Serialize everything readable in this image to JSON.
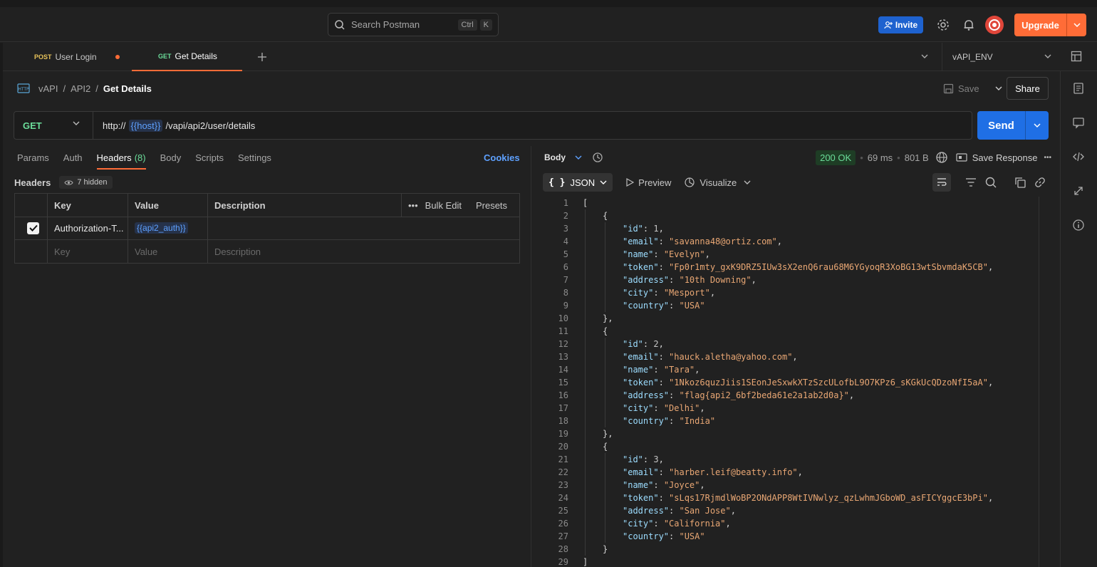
{
  "topbar": {
    "search_placeholder": "Search Postman",
    "kbd": [
      "Ctrl",
      "K"
    ],
    "invite_label": "Invite",
    "upgrade_label": "Upgrade"
  },
  "tabs": [
    {
      "method": "POST",
      "name": "User Login",
      "unsaved": true
    },
    {
      "method": "GET",
      "name": "Get Details",
      "active": true
    }
  ],
  "environment": "vAPI_ENV",
  "breadcrumb": {
    "badge": "HTTP",
    "items": [
      "vAPI",
      "API2"
    ],
    "current": "Get Details"
  },
  "actions": {
    "save": "Save",
    "share": "Share"
  },
  "request": {
    "method": "GET",
    "url_prefix": "http://",
    "url_var": "{{host}}",
    "url_path": "/vapi/api2/user/details",
    "send_label": "Send"
  },
  "request_tabs": {
    "params": "Params",
    "auth": "Auth",
    "headers": "Headers",
    "headers_count": "(8)",
    "body": "Body",
    "scripts": "Scripts",
    "settings": "Settings",
    "cookies": "Cookies"
  },
  "headers_section": {
    "title": "Headers",
    "hidden": "7 hidden",
    "columns": [
      "Key",
      "Value",
      "Description"
    ],
    "bulk_edit": "Bulk Edit",
    "presets": "Presets",
    "row": {
      "key": "Authorization-T...",
      "value": "{{api2_auth}}",
      "description": ""
    },
    "placeholders": {
      "key": "Key",
      "value": "Value",
      "description": "Description"
    }
  },
  "response": {
    "body_label": "Body",
    "status": "200 OK",
    "time": "69 ms",
    "size": "801 B",
    "save_response": "Save Response",
    "format": "JSON",
    "preview": "Preview",
    "visualize": "Visualize"
  },
  "code_lines": [
    "1",
    "2",
    "3",
    "4",
    "5",
    "6",
    "7",
    "8",
    "9",
    "10",
    "11",
    "12",
    "13",
    "14",
    "15",
    "16",
    "17",
    "18",
    "19",
    "20",
    "21",
    "22",
    "23",
    "24",
    "25",
    "26",
    "27",
    "28",
    "29"
  ],
  "json_body": [
    {
      "id": "1",
      "email": "\"savanna48@ortiz.com\"",
      "name": "\"Evelyn\"",
      "token": "\"Fp0r1mty_gxK9DRZ5IUw3sX2enQ6rau68M6YGyoqR3XoBG13wtSbvmdaK5CB\"",
      "address": "\"10th Downing\"",
      "city": "\"Mesport\"",
      "country": "\"USA\""
    },
    {
      "id": "2",
      "email": "\"hauck.aletha@yahoo.com\"",
      "name": "\"Tara\"",
      "token": "\"1Nkoz6quzJiis1SEonJeSxwkXTzSzcULofbL9O7KPz6_sKGkUcQDzoNfI5aA\"",
      "address": "\"flag{api2_6bf2beda61e2a1ab2d0a}\"",
      "city": "\"Delhi\"",
      "country": "\"India\""
    },
    {
      "id": "3",
      "email": "\"harber.leif@beatty.info\"",
      "name": "\"Joyce\"",
      "token": "\"sLqs17RjmdlWoBP2ONdAPP8WtIVNwlyz_qzLwhmJGboWD_asFICYggcE3bPi\"",
      "address": "\"San Jose\"",
      "city": "\"California\"",
      "country": "\"USA\""
    }
  ]
}
